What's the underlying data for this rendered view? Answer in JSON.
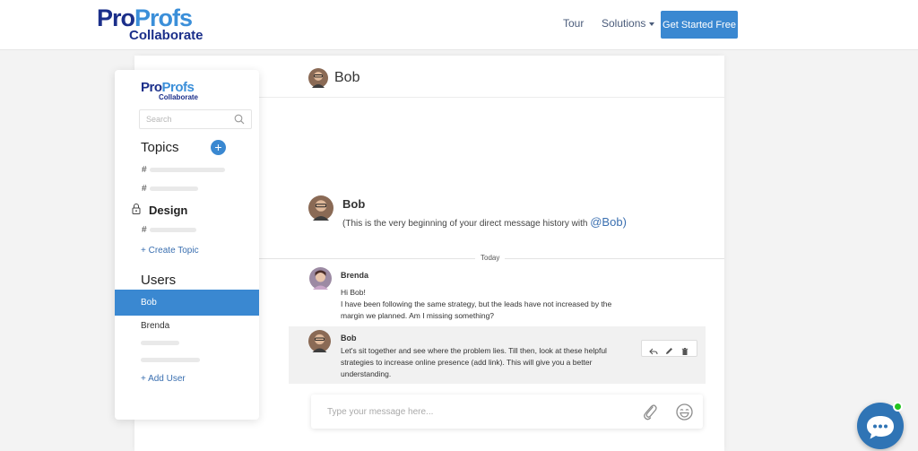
{
  "brand": {
    "word1": "Pro",
    "word2": "Profs",
    "product": "Collaborate"
  },
  "nav": {
    "tour": "Tour",
    "solutions": "Solutions",
    "cta": "Get Started Free"
  },
  "sidebar": {
    "logo": {
      "word1": "Pro",
      "word2": "Profs",
      "product": "Collaborate"
    },
    "search_placeholder": "Search",
    "topics_heading": "Topics",
    "add_topic_symbol": "+",
    "hash": "#",
    "design_topic": "Design",
    "create_topic": "+ Create Topic",
    "users_heading": "Users",
    "users": [
      "Bob",
      "Brenda"
    ],
    "add_user": "+ Add User"
  },
  "chat": {
    "header_name": "Bob",
    "intro": {
      "name": "Bob",
      "text": "(This is the very beginning of your direct message history with ",
      "mention": "@Bob",
      "close": ")"
    },
    "today_label": "Today",
    "messages": [
      {
        "author": "Brenda",
        "lines": [
          "Hi Bob!",
          "I have been following the same strategy, but the leads have not increased by the",
          "margin we planned. Am I missing something?"
        ]
      },
      {
        "author": "Bob",
        "lines": [
          "Let's sit together and see where the problem lies. Till then, look at these helpful",
          "strategies to increase online presence (add link). This will give you a better",
          "understanding."
        ]
      }
    ],
    "compose_placeholder": "Type your message here..."
  },
  "colors": {
    "accent": "#3a88d1",
    "brand_dark": "#1b2f8a",
    "online": "#22c51f"
  }
}
